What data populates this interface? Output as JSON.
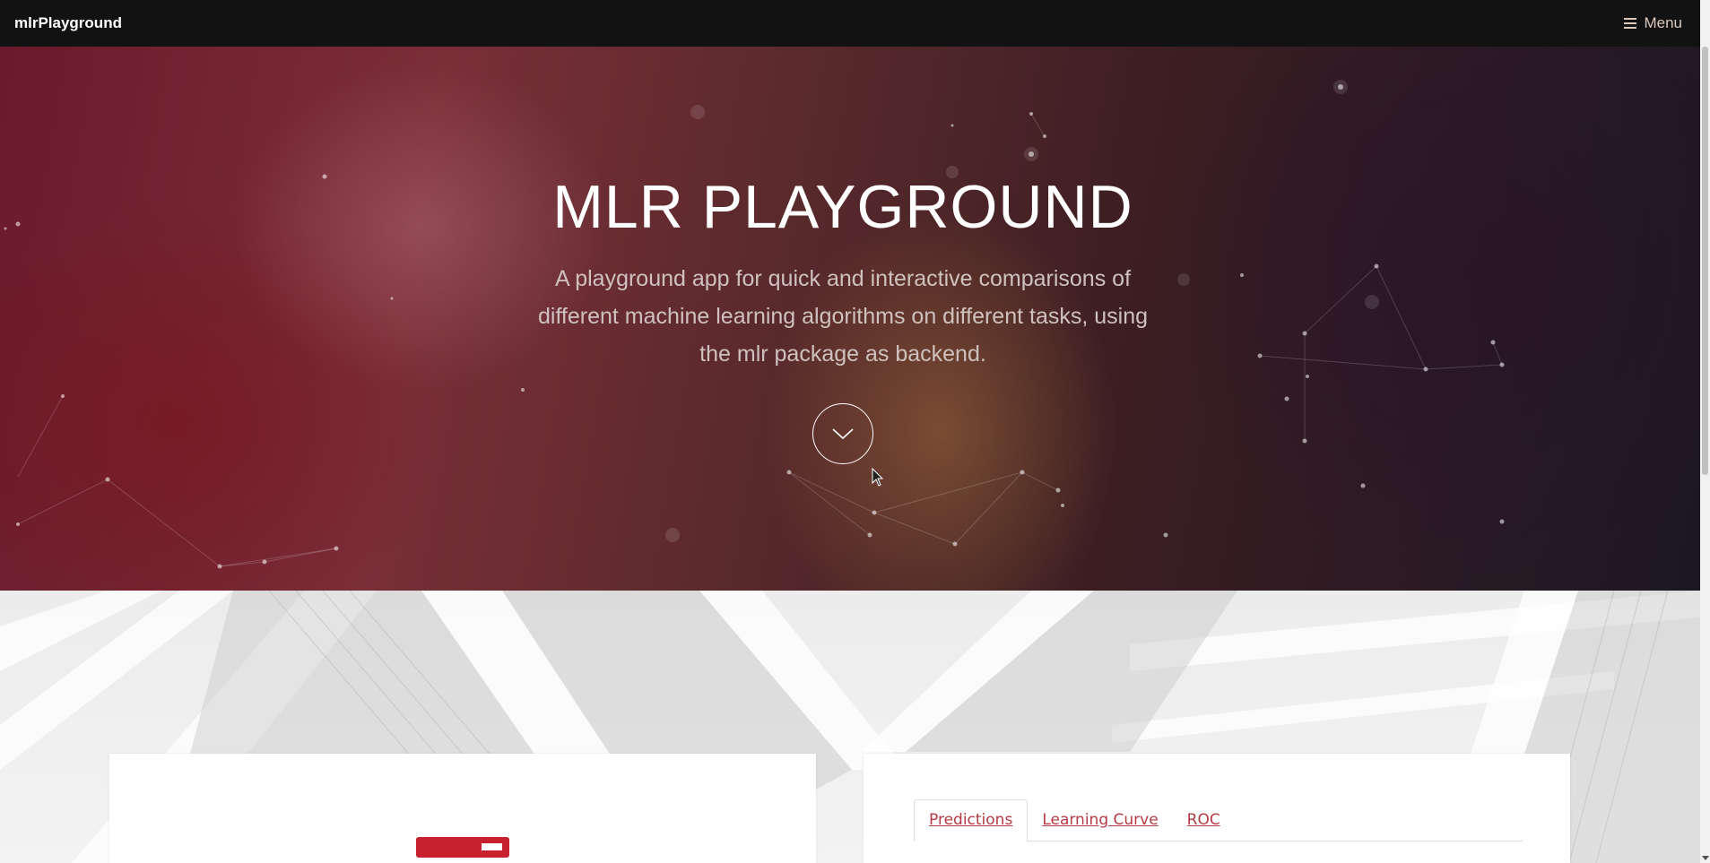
{
  "navbar": {
    "brand": "mlrPlayground",
    "menu_label": "Menu",
    "menu_icon": "hamburger-icon"
  },
  "hero": {
    "title": "MLR PLAYGROUND",
    "subtitle": "A playground app for quick and interactive comparisons of different machine learning algorithms on different tasks, using the mlr package as backend.",
    "scroll_icon": "chevron-down-icon"
  },
  "tabs": [
    {
      "label": "Predictions",
      "active": true
    },
    {
      "label": "Learning Curve",
      "active": false
    },
    {
      "label": "ROC",
      "active": false
    }
  ],
  "colors": {
    "accent": "#c8202e",
    "navbar": "#121212",
    "tab_link": "#b53a44"
  }
}
